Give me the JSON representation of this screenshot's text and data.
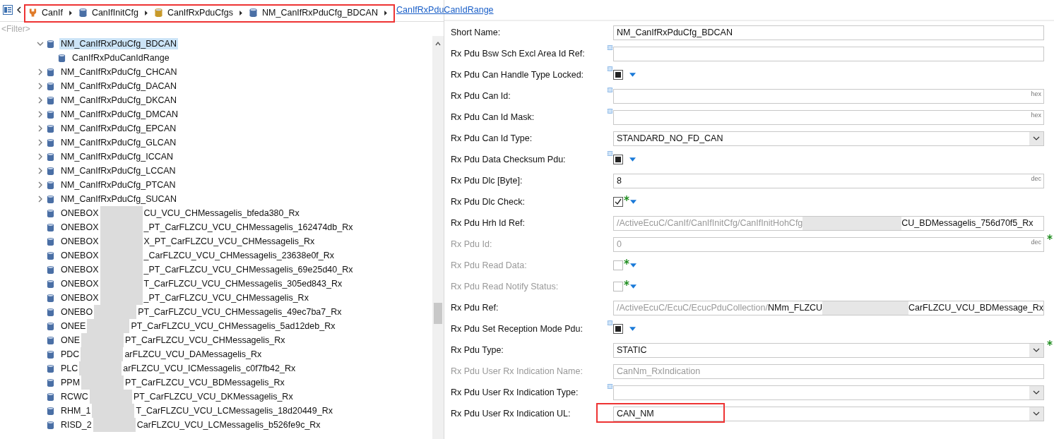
{
  "breadcrumb": {
    "highlighted": true,
    "items": [
      {
        "label": "CanIf",
        "kind": "module"
      },
      {
        "label": "CanIfInitCfg",
        "kind": "container"
      },
      {
        "label": "CanIfRxPduCfgs",
        "kind": "list"
      },
      {
        "label": "NM_CanIfRxPduCfg_BDCAN",
        "kind": "container"
      }
    ],
    "current": "CanIfRxPduCanIdRange"
  },
  "filter": {
    "placeholder": "<Filter>"
  },
  "tree": [
    {
      "label": "NM_CanIfRxPduCfg_BDCAN",
      "expanded": true,
      "selected": true,
      "children": [
        {
          "label": "CanIfRxPduCanIdRange",
          "selected": false
        }
      ]
    },
    {
      "label": "NM_CanIfRxPduCfg_CHCAN",
      "expanded": false,
      "selected": false
    },
    {
      "label": "NM_CanIfRxPduCfg_DACAN",
      "expanded": false,
      "selected": false
    },
    {
      "label": "NM_CanIfRxPduCfg_DKCAN",
      "expanded": false,
      "selected": false
    },
    {
      "label": "NM_CanIfRxPduCfg_DMCAN",
      "expanded": false,
      "selected": false
    },
    {
      "label": "NM_CanIfRxPduCfg_EPCAN",
      "expanded": false,
      "selected": false
    },
    {
      "label": "NM_CanIfRxPduCfg_GLCAN",
      "expanded": false,
      "selected": false
    },
    {
      "label": "NM_CanIfRxPduCfg_ICCAN",
      "expanded": false,
      "selected": false
    },
    {
      "label": "NM_CanIfRxPduCfg_LCCAN",
      "expanded": false,
      "selected": false
    },
    {
      "label": "NM_CanIfRxPduCfg_PTCAN",
      "expanded": false,
      "selected": false
    },
    {
      "label": "NM_CanIfRxPduCfg_SUCAN",
      "expanded": false,
      "selected": false
    },
    {
      "label": "ONEBOX",
      "tail": "CU_VCU_CHMessagelis_bfeda380_Rx",
      "selected": false
    },
    {
      "label": "ONEBOX",
      "tail": "_PT_CarFLZCU_VCU_CHMessagelis_162474db_Rx",
      "selected": false
    },
    {
      "label": "ONEBOX",
      "tail": "X_PT_CarFLZCU_VCU_CHMessagelis_Rx",
      "selected": false
    },
    {
      "label": "ONEBOX",
      "tail": "_CarFLZCU_VCU_CHMessagelis_23638e0f_Rx",
      "selected": false
    },
    {
      "label": "ONEBOX",
      "tail": "_PT_CarFLZCU_VCU_CHMessagelis_69e25d40_Rx",
      "selected": false
    },
    {
      "label": "ONEBOX",
      "tail": "T_CarFLZCU_VCU_CHMessagelis_305ed843_Rx",
      "selected": false
    },
    {
      "label": "ONEBOX",
      "tail": "_PT_CarFLZCU_VCU_CHMessagelis_Rx",
      "selected": false
    },
    {
      "label": "ONEBO",
      "tail": "PT_CarFLZCU_VCU_CHMessagelis_49ec7ba7_Rx",
      "selected": false
    },
    {
      "label": "ONEE",
      "tail": "PT_CarFLZCU_VCU_CHMessagelis_5ad12deb_Rx",
      "selected": false
    },
    {
      "label": "ONE",
      "tail": "PT_CarFLZCU_VCU_CHMessagelis_Rx",
      "selected": false
    },
    {
      "label": "PDC",
      "tail": "arFLZCU_VCU_DAMessagelis_Rx",
      "selected": false
    },
    {
      "label": "PLC",
      "tail": "arFLZCU_VCU_ICMessagelis_c0f7fb42_Rx",
      "selected": false
    },
    {
      "label": "PPM",
      "tail": "PT_CarFLZCU_VCU_BDMessagelis_Rx",
      "selected": false
    },
    {
      "label": "RCWC",
      "tail": "PT_CarFLZCU_VCU_DKMessagelis_Rx",
      "selected": false
    },
    {
      "label": "RHM_1",
      "tail": "T_CarFLZCU_VCU_LCMessagelis_18d20449_Rx",
      "selected": false
    },
    {
      "label": "RISD_2",
      "tail": "CarFLZCU_VCU_LCMessagelis_b526fe9c_Rx",
      "selected": false
    }
  ],
  "form": [
    {
      "kind": "text",
      "label": "Short Name:",
      "value": "NM_CanIfRxPduCfg_BDCAN"
    },
    {
      "kind": "text",
      "label": "Rx Pdu Bsw Sch Excl Area Id Ref:",
      "ref_icon": true
    },
    {
      "kind": "check",
      "label": "Rx Pdu Can Handle Type Locked:",
      "checked": false,
      "mixed": true,
      "ref_icon": true,
      "menu": true
    },
    {
      "kind": "text",
      "label": "Rx Pdu Can Id:",
      "unit": "hex",
      "ref_icon": true
    },
    {
      "kind": "text",
      "label": "Rx Pdu Can Id Mask:",
      "unit": "hex",
      "ref_icon": true
    },
    {
      "kind": "combo",
      "label": "Rx Pdu Can Id Type:",
      "value": "STANDARD_NO_FD_CAN"
    },
    {
      "kind": "check",
      "label": "Rx Pdu Data Checksum Pdu:",
      "checked": false,
      "mixed": true,
      "ref_icon": true,
      "menu": true
    },
    {
      "kind": "text",
      "label": "Rx Pdu Dlc [Byte]:",
      "value": "8",
      "unit": "dec"
    },
    {
      "kind": "check",
      "label": "Rx Pdu Dlc Check:",
      "checked": true,
      "star": true,
      "menu": true
    },
    {
      "kind": "ref",
      "label": "Rx Pdu Hrh Id Ref:",
      "prefix": "/ActiveEcuC/CanIf/CanIfInitCfg/CanIfInitHohCfg",
      "tail": "CU_BDMessagelis_756d70f5_Rx"
    },
    {
      "kind": "text",
      "label": "Rx Pdu Id:",
      "value": "0",
      "unit": "dec",
      "disabled": true,
      "star": true
    },
    {
      "kind": "check",
      "label": "Rx Pdu Read Data:",
      "checked": false,
      "disabled": true,
      "star": true,
      "menu": true
    },
    {
      "kind": "check",
      "label": "Rx Pdu Read Notify Status:",
      "checked": false,
      "disabled": true,
      "star": true,
      "menu": true
    },
    {
      "kind": "ref",
      "label": "Rx Pdu Ref:",
      "prefix": "/ActiveEcuC/EcuC/EcucPduCollection/",
      "value": "NMm_FLZCU",
      "tail": "CarFLZCU_VCU_BDMessage_Rx"
    },
    {
      "kind": "check",
      "label": "Rx Pdu Set Reception Mode Pdu:",
      "checked": false,
      "mixed": true,
      "ref_icon": true,
      "menu": true
    },
    {
      "kind": "combo",
      "label": "Rx Pdu Type:",
      "value": "STATIC",
      "star": true
    },
    {
      "kind": "text",
      "label": "Rx Pdu User Rx Indication Name:",
      "value": "CanNm_RxIndication",
      "disabled": true
    },
    {
      "kind": "combo",
      "label": "Rx Pdu User Rx Indication Type:",
      "ref_icon": true
    },
    {
      "kind": "combo",
      "label": "Rx Pdu User Rx Indication UL:",
      "value": "CAN_NM",
      "highlighted": true
    }
  ]
}
